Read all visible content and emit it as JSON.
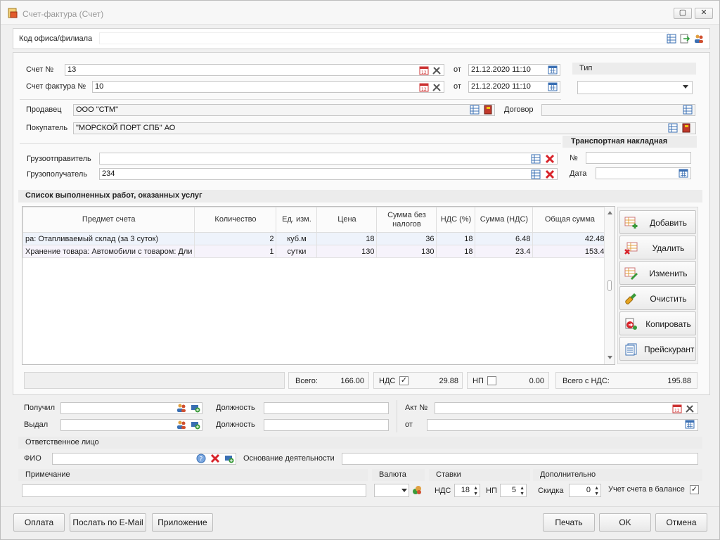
{
  "window": {
    "title": "Счет-фактура (Счет)",
    "restore_glyph": "▢",
    "close_glyph": "✕"
  },
  "office": {
    "label": "Код офиса/филиала",
    "value": ""
  },
  "invoice": {
    "account_no_label": "Счет №",
    "account_no": "13",
    "invoice_no_label": "Счет фактура №",
    "invoice_no": "10",
    "from_label": "от",
    "date1": "21.12.2020 11:10",
    "date2": "21.12.2020 11:10",
    "type_label": "Тип",
    "type_value": ""
  },
  "parties": {
    "seller_label": "Продавец",
    "seller": "ООО \"СТМ\"",
    "contract_label": "Договор",
    "contract": "",
    "buyer_label": "Покупатель",
    "buyer": "\"МОРСКОЙ ПОРТ СПБ\" АО"
  },
  "cargo": {
    "shipper_label": "Грузоотправитель",
    "shipper": "",
    "consignee_label": "Грузополучатель",
    "consignee": "234",
    "waybill_title": "Транспортная накладная",
    "waybill_no_label": "№",
    "waybill_no": "",
    "waybill_date_label": "Дата",
    "waybill_date": ""
  },
  "services": {
    "title": "Список выполненных работ, оказанных услуг",
    "columns": [
      "Предмет счета",
      "Количество",
      "Ед. изм.",
      "Цена",
      "Сумма без налогов",
      "НДС (%)",
      "Сумма (НДС)",
      "Общая сумма"
    ],
    "rows": [
      [
        "ра: Отапливаемый склад (за 3 суток)",
        "2",
        "куб.м",
        "18",
        "36",
        "18",
        "6.48",
        "42.48"
      ],
      [
        "Хранение товара: Автомобили с товаром: Дли",
        "1",
        "сутки",
        "130",
        "130",
        "18",
        "23.4",
        "153.4"
      ]
    ],
    "side_buttons": [
      "Добавить",
      "Удалить",
      "Изменить",
      "Очистить",
      "Копировать",
      "Прейскурант"
    ]
  },
  "totals": {
    "total_label": "Всего:",
    "total": "166.00",
    "vat_label": "НДС",
    "vat_checked": true,
    "vat": "29.88",
    "np_label": "НП",
    "np_checked": false,
    "np": "0.00",
    "total_vat_label": "Всего с НДС:",
    "total_vat": "195.88"
  },
  "signers": {
    "received_label": "Получил",
    "received": "",
    "issued_label": "Выдал",
    "issued": "",
    "position_label": "Должность",
    "position1": "",
    "position2": "",
    "act_label": "Акт №",
    "act_no": "",
    "act_from_label": "от",
    "act_date": ""
  },
  "responsible": {
    "title": "Ответственное лицо",
    "fio_label": "ФИО",
    "fio": "",
    "basis_label": "Основание деятельности",
    "basis": ""
  },
  "bottom": {
    "note_title": "Примечание",
    "note": "",
    "currency_title": "Валюта",
    "currency": "",
    "rates_title": "Ставки",
    "vat_rate_label": "НДС",
    "vat_rate": "18",
    "np_rate_label": "НП",
    "np_rate": "5",
    "extra_title": "Дополнительно",
    "discount_label": "Скидка",
    "discount": "0",
    "balance_label": "Учет счета в балансе",
    "balance_checked": true
  },
  "footer": {
    "pay": "Оплата",
    "email": "Послать по E-Mail",
    "attachment": "Приложение",
    "print": "Печать",
    "ok": "OK",
    "cancel": "Отмена"
  },
  "colors": {
    "accent_blue": "#3a6fb3",
    "delete_red": "#d8232a",
    "add_green": "#3a9a3a"
  }
}
